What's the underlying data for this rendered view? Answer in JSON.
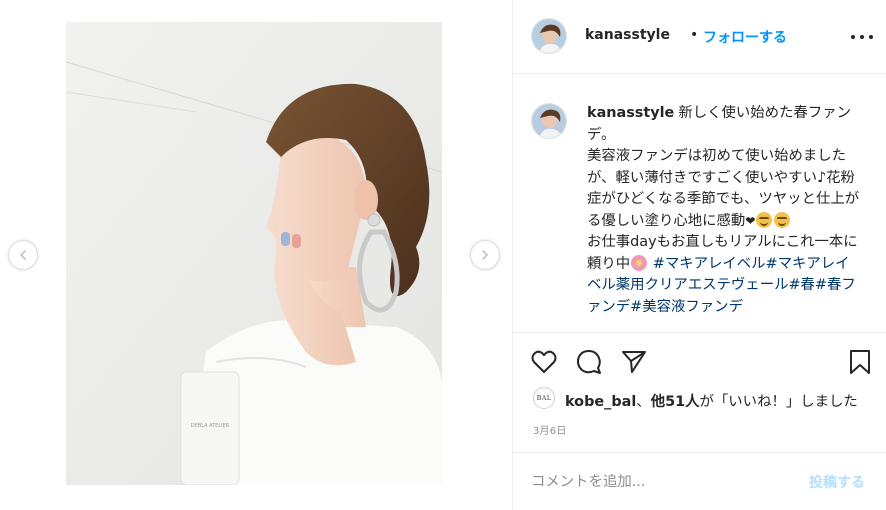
{
  "post": {
    "username": "kanasstyle",
    "separator": "•",
    "follow_label": "フォローする",
    "caption": {
      "line_head": "新しく使い始めた春ファンデ。",
      "body1": "美容液ファンデは初めて使い始めましたが、軽い薄付きですごく使いやすい♪花粉症がひどくなる季節でも、ツヤッと仕上がる優しい塗り心地に感動",
      "heart": "❤",
      "body2": "お仕事dayもお直しもリアルにこれ一本に頼り中",
      "hashtags": "#マキアレイベル#マキアレイベル薬用クリアエステヴェール#春#春ファンデ#美容液ファンデ"
    },
    "likes": {
      "avatar_text": "BAL",
      "user": "kobe_bal",
      "sep": "、",
      "others": "他51人",
      "suffix": "が「いいね！」しました"
    },
    "date": "3月6日",
    "comment_placeholder": "コメントを追加...",
    "post_button": "投稿する",
    "product_text": "DEBLA ATELIER"
  },
  "icons": {
    "prev": "chevron-left-icon",
    "next": "chevron-right-icon",
    "more": "more-options-icon",
    "like": "heart-icon",
    "comment": "comment-bubble-icon",
    "share": "paper-plane-icon",
    "save": "bookmark-icon"
  },
  "colors": {
    "accent": "#0095f6",
    "hashtag": "#00376b",
    "post_disabled": "#b2dffc",
    "meta": "#8e8e8e"
  }
}
